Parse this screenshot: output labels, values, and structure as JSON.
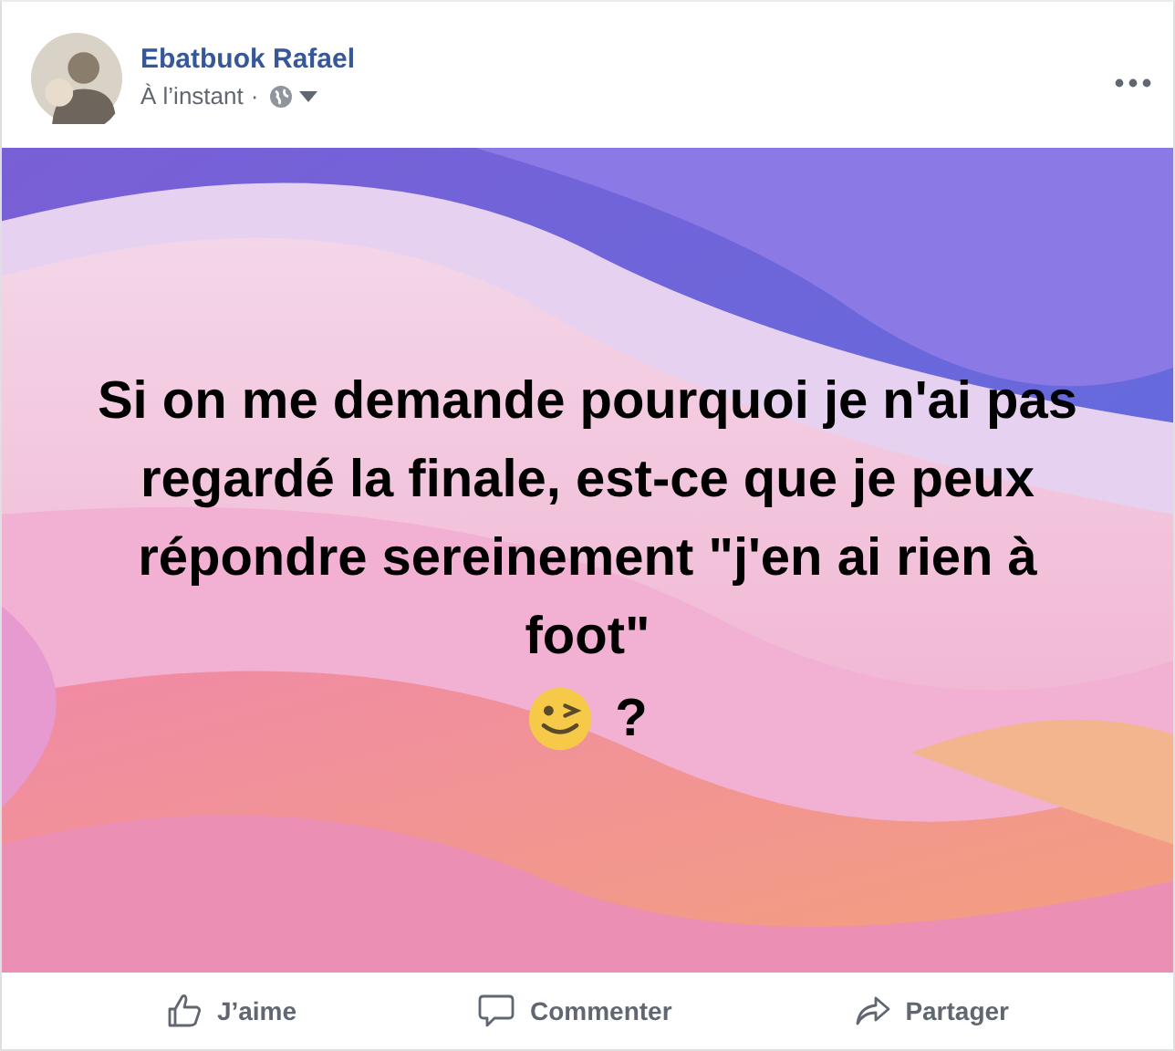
{
  "post": {
    "author": "Ebatbuok Rafael",
    "time": "À l’instant",
    "separator": "·",
    "text": "Si on me demande pourquoi je n'ai pas regardé la finale, est-ce que je peux répondre sereinement \"j'en ai rien à foot\"",
    "text_end": "?"
  },
  "actions": [
    {
      "kind": "like",
      "label": "J’aime"
    },
    {
      "kind": "comment",
      "label": "Commenter"
    },
    {
      "kind": "share",
      "label": "Partager"
    }
  ]
}
